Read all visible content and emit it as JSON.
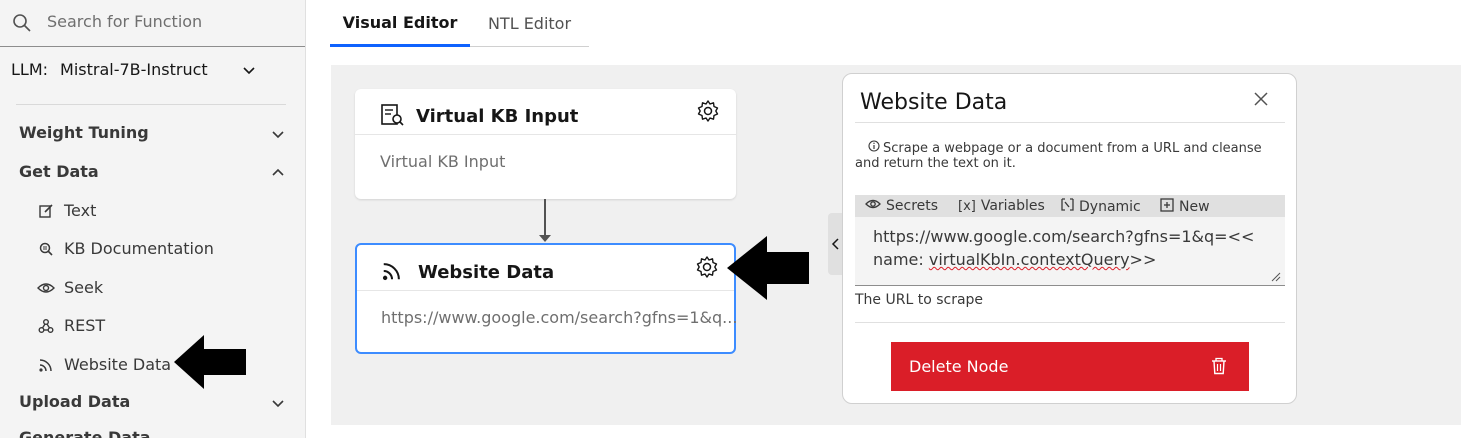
{
  "sidebar": {
    "search_placeholder": "Search for Function",
    "llm_label": "LLM:",
    "llm_value": "Mistral-7B-Instruct",
    "sections": {
      "weight_tuning": "Weight Tuning",
      "get_data": "Get Data",
      "upload_data": "Upload Data",
      "next_partial": "Generate Data"
    },
    "items": [
      {
        "label": "Text",
        "icon": "edit-icon"
      },
      {
        "label": "KB Documentation",
        "icon": "document-search-icon"
      },
      {
        "label": "Seek",
        "icon": "eye-icon"
      },
      {
        "label": "REST",
        "icon": "webhook-icon"
      },
      {
        "label": "Website Data",
        "icon": "rss-feed-icon"
      }
    ]
  },
  "tabs": {
    "visual": "Visual Editor",
    "ntl": "NTL Editor"
  },
  "canvas": {
    "node1": {
      "title": "Virtual KB Input",
      "body": "Virtual KB Input",
      "icon": "virtual-kb-icon"
    },
    "node2": {
      "title": "Website Data",
      "body": "https://www.google.com/search?gfns=1&q...",
      "icon": "rss-feed-icon"
    }
  },
  "panel": {
    "title": "Website Data",
    "description": "Scrape a webpage or a document from a URL and cleanse and return the text on it.",
    "toolbar": {
      "secrets": "Secrets",
      "variables": "Variables",
      "dynamic": "Dynamic",
      "new": "New"
    },
    "url_line1": "https://www.google.com/search?gfns=1&q=<<",
    "url_line2_prefix": "name: ",
    "url_line2_var": "virtualKbIn.contextQuery",
    "url_line2_suffix": ">>",
    "hint": "The URL to scrape",
    "delete_label": "Delete Node"
  },
  "colors": {
    "accent": "#0f62fe",
    "node_selected_border": "#3d8cff",
    "danger": "#da1e28"
  }
}
